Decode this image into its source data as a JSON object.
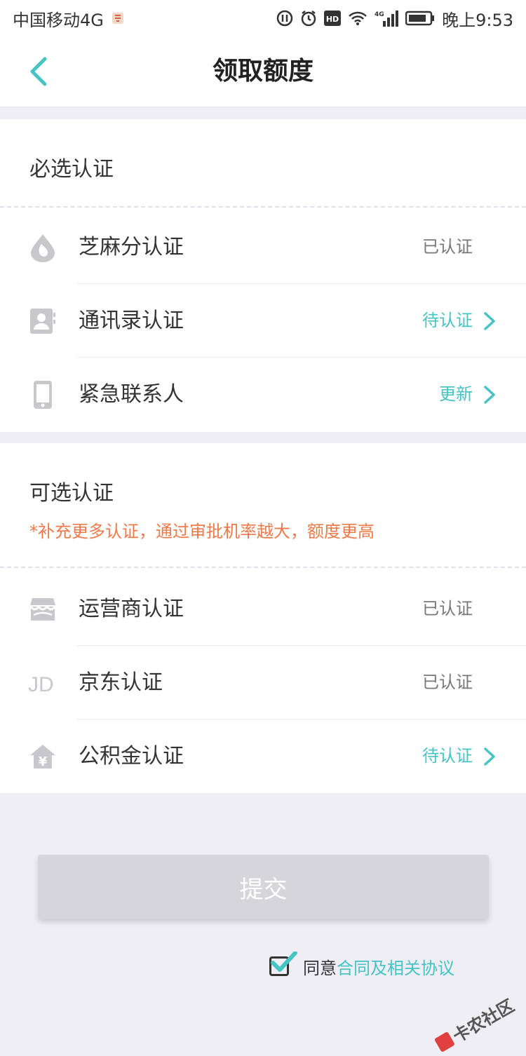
{
  "status_bar": {
    "carrier": "中国移动4G",
    "time": "晚上9:53",
    "icons": [
      "notification-icon",
      "data-saver-icon",
      "alarm-icon",
      "hd-icon",
      "wifi-icon",
      "4g-signal-icon",
      "battery-icon"
    ],
    "hd_text": "HD",
    "net_text": "4G"
  },
  "nav": {
    "title": "领取额度",
    "back_icon": "back-chevron-icon"
  },
  "required": {
    "title": "必选认证",
    "items": [
      {
        "icon": "sesame-drop-icon",
        "label": "芝麻分认证",
        "status": "已认证",
        "pending": false,
        "chevron": false
      },
      {
        "icon": "contacts-book-icon",
        "label": "通讯录认证",
        "status": "待认证",
        "pending": true,
        "chevron": true
      },
      {
        "icon": "mobile-phone-icon",
        "label": "紧急联系人",
        "status": "更新",
        "pending": true,
        "chevron": true
      }
    ]
  },
  "optional": {
    "title": "可选认证",
    "hint": "*补充更多认证，通过审批机率越大，额度更高",
    "items": [
      {
        "icon": "carrier-store-icon",
        "label": "运营商认证",
        "status": "已认证",
        "pending": false,
        "chevron": false
      },
      {
        "icon": "jd-logo-icon",
        "label": "京东认证",
        "status": "已认证",
        "pending": false,
        "chevron": false
      },
      {
        "icon": "housing-fund-icon",
        "label": "公积金认证",
        "status": "待认证",
        "pending": true,
        "chevron": true
      }
    ]
  },
  "jd_text": "JD",
  "yen_text": "¥",
  "submit_label": "提交",
  "agreement": {
    "checked": true,
    "prefix": "同意",
    "link": "合同及相关协议"
  },
  "watermark": "卡农社区",
  "colors": {
    "accent": "#46c3c3",
    "hint": "#ee7a4a",
    "icon_gray": "#c8c8cc",
    "button_disabled": "#d6d6da",
    "background": "#eeeef4"
  }
}
